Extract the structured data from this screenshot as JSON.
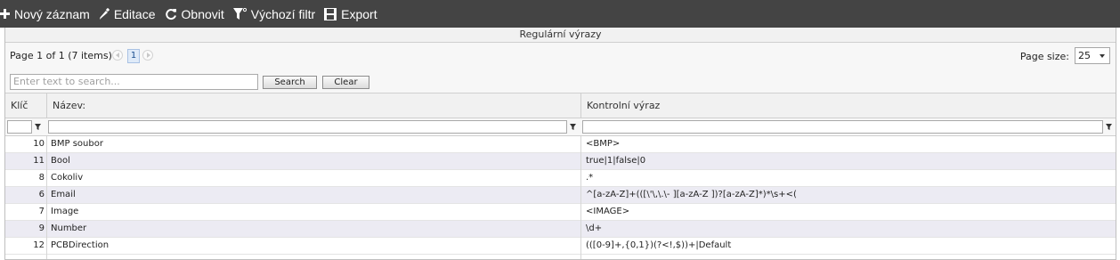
{
  "toolbar": {
    "new_label": "Nový záznam",
    "edit_label": "Editace",
    "refresh_label": "Obnovit",
    "default_filter_label": "Výchozí filtr",
    "export_label": "Export"
  },
  "grid": {
    "title": "Regulární výrazy",
    "pager": {
      "summary": "Page 1 of 1 (7 items)",
      "current_page": "1",
      "page_size_label": "Page size:",
      "page_size_value": "25"
    },
    "search": {
      "placeholder": "Enter text to search...",
      "search_label": "Search",
      "clear_label": "Clear"
    },
    "columns": [
      "Klíč",
      "Název:",
      "Kontrolní výraz"
    ],
    "rows": [
      {
        "key": "10",
        "name": "BMP soubor",
        "expr": "<BMP>"
      },
      {
        "key": "11",
        "name": "Bool",
        "expr": "true|1|false|0"
      },
      {
        "key": "8",
        "name": "Cokoliv",
        "expr": ".*"
      },
      {
        "key": "6",
        "name": "Email",
        "expr": "^[a-zA-Z]+(([\\'\\,\\.\\- ][a-zA-Z ])?[a-zA-Z]*)*\\s+<("
      },
      {
        "key": "7",
        "name": "Image",
        "expr": "<IMAGE>"
      },
      {
        "key": "9",
        "name": "Number",
        "expr": "\\d+"
      },
      {
        "key": "12",
        "name": "PCBDirection",
        "expr": "(([0-9]+,{0,1})(?<!,$))+|Default"
      }
    ]
  },
  "colors": {
    "toolbar_bg": "#444444",
    "alt_row_bg": "#ecebf3",
    "header_bg": "#f1f1f1"
  }
}
